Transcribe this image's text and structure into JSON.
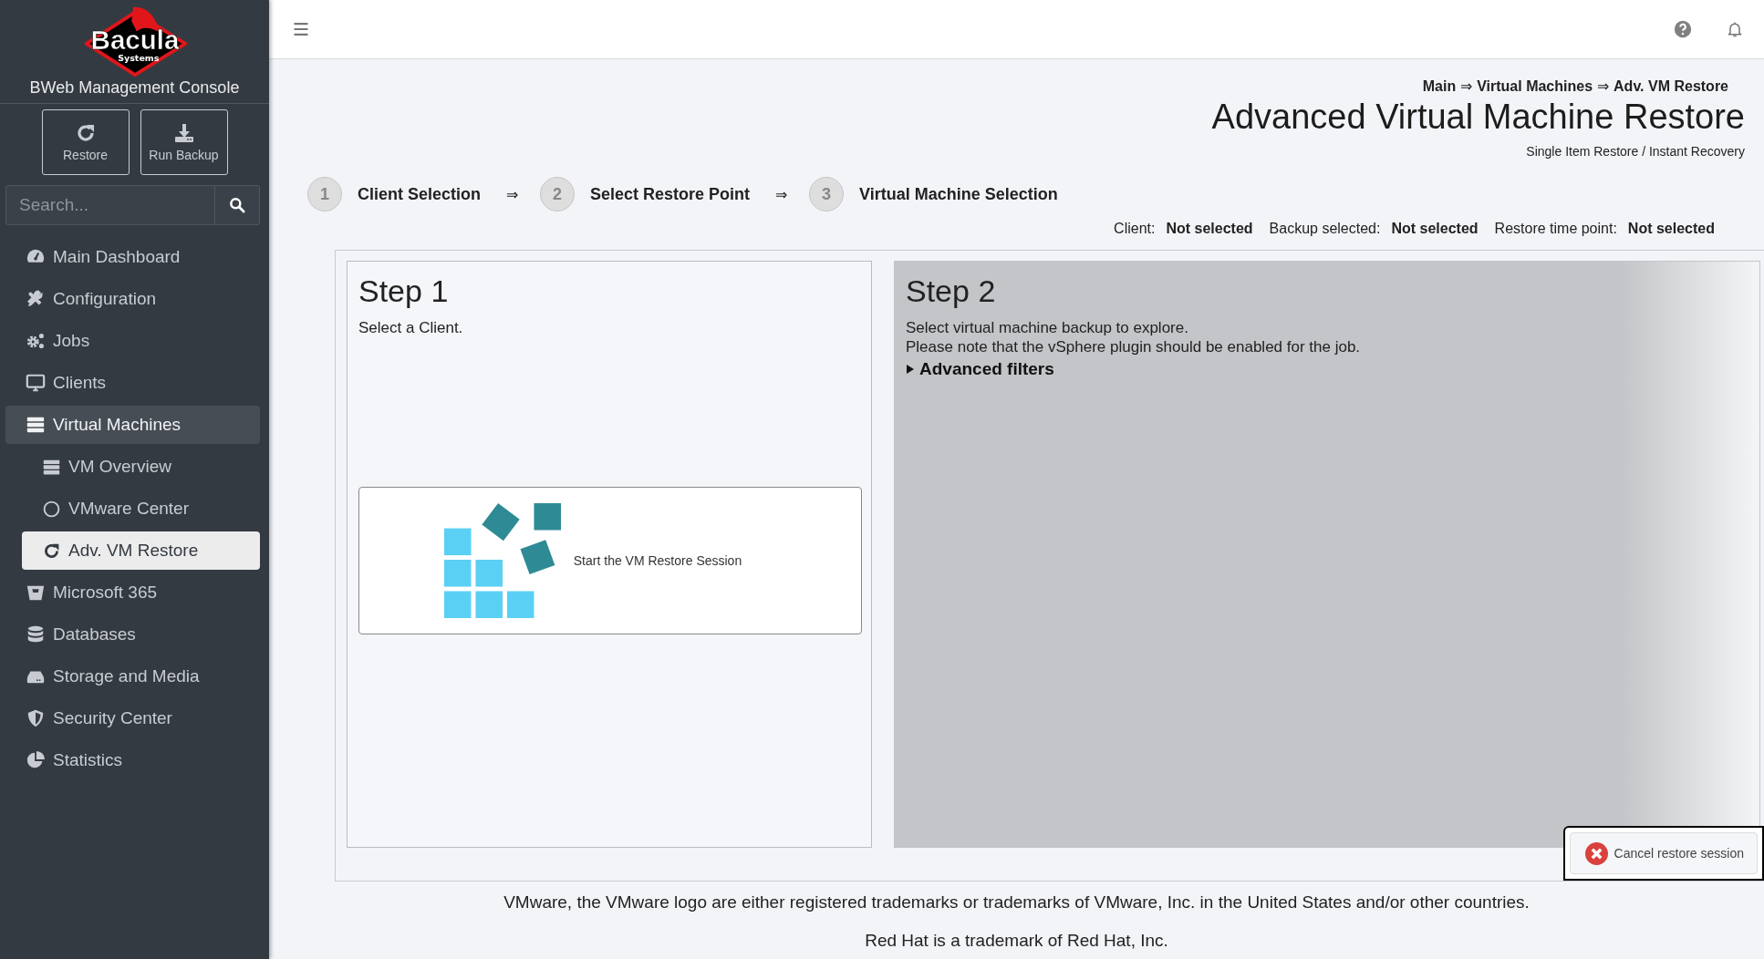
{
  "sidebar": {
    "logo": {
      "word": "Bacula",
      "subword": "Systems"
    },
    "title": "BWeb Management Console",
    "actions": [
      {
        "label": "Restore"
      },
      {
        "label": "Run Backup"
      }
    ],
    "search": {
      "placeholder": "Search..."
    },
    "items": [
      {
        "label": "Main Dashboard",
        "expanded": false,
        "selected": false
      },
      {
        "label": "Configuration",
        "expanded": false,
        "selected": false
      },
      {
        "label": "Jobs",
        "expanded": false,
        "selected": false
      },
      {
        "label": "Clients",
        "expanded": false,
        "selected": false
      },
      {
        "label": "Virtual Machines",
        "expanded": true,
        "selected": false,
        "children": [
          {
            "label": "VM Overview",
            "selected": false
          },
          {
            "label": "VMware Center",
            "selected": false
          },
          {
            "label": "Adv. VM Restore",
            "selected": true
          }
        ]
      },
      {
        "label": "Microsoft 365",
        "expanded": false,
        "selected": false
      },
      {
        "label": "Databases",
        "expanded": false,
        "selected": false
      },
      {
        "label": "Storage and Media",
        "expanded": false,
        "selected": false
      },
      {
        "label": "Security Center",
        "expanded": false,
        "selected": false
      },
      {
        "label": "Statistics",
        "expanded": false,
        "selected": false
      }
    ]
  },
  "breadcrumb": [
    "Main",
    "Virtual Machines",
    "Adv. VM Restore"
  ],
  "breadcrumb_separator": "⇒",
  "page": {
    "title": "Advanced Virtual Machine Restore",
    "subtitle": "Single Item Restore / Instant Recovery"
  },
  "steps": [
    {
      "number": "1",
      "label": "Client Selection"
    },
    {
      "number": "2",
      "label": "Select Restore Point"
    },
    {
      "number": "3",
      "label": "Virtual Machine Selection"
    }
  ],
  "step_separator": "⇒",
  "summary": [
    {
      "label": "Client:",
      "value": "Not selected"
    },
    {
      "label": "Backup selected:",
      "value": "Not selected"
    },
    {
      "label": "Restore time point:",
      "value": "Not selected"
    }
  ],
  "panels": [
    {
      "title": "Step 1",
      "disabled": false,
      "lines": [
        "Select a Client."
      ],
      "action": {
        "label": "Start the VM Restore Session"
      }
    },
    {
      "title": "Step 2",
      "disabled": true,
      "lines": [
        "Select virtual machine backup to explore.",
        "Please note that the vSphere plugin should be enabled for the job."
      ],
      "disclosure": {
        "label": "Advanced filters",
        "expanded": false
      }
    }
  ],
  "cancel_button": {
    "label": "Cancel restore session"
  },
  "footer": [
    "VMware, the VMware logo are either registered trademarks or trademarks of VMware, Inc. in the United States and/or other countries.",
    "Red Hat is a trademark of Red Hat, Inc."
  ]
}
